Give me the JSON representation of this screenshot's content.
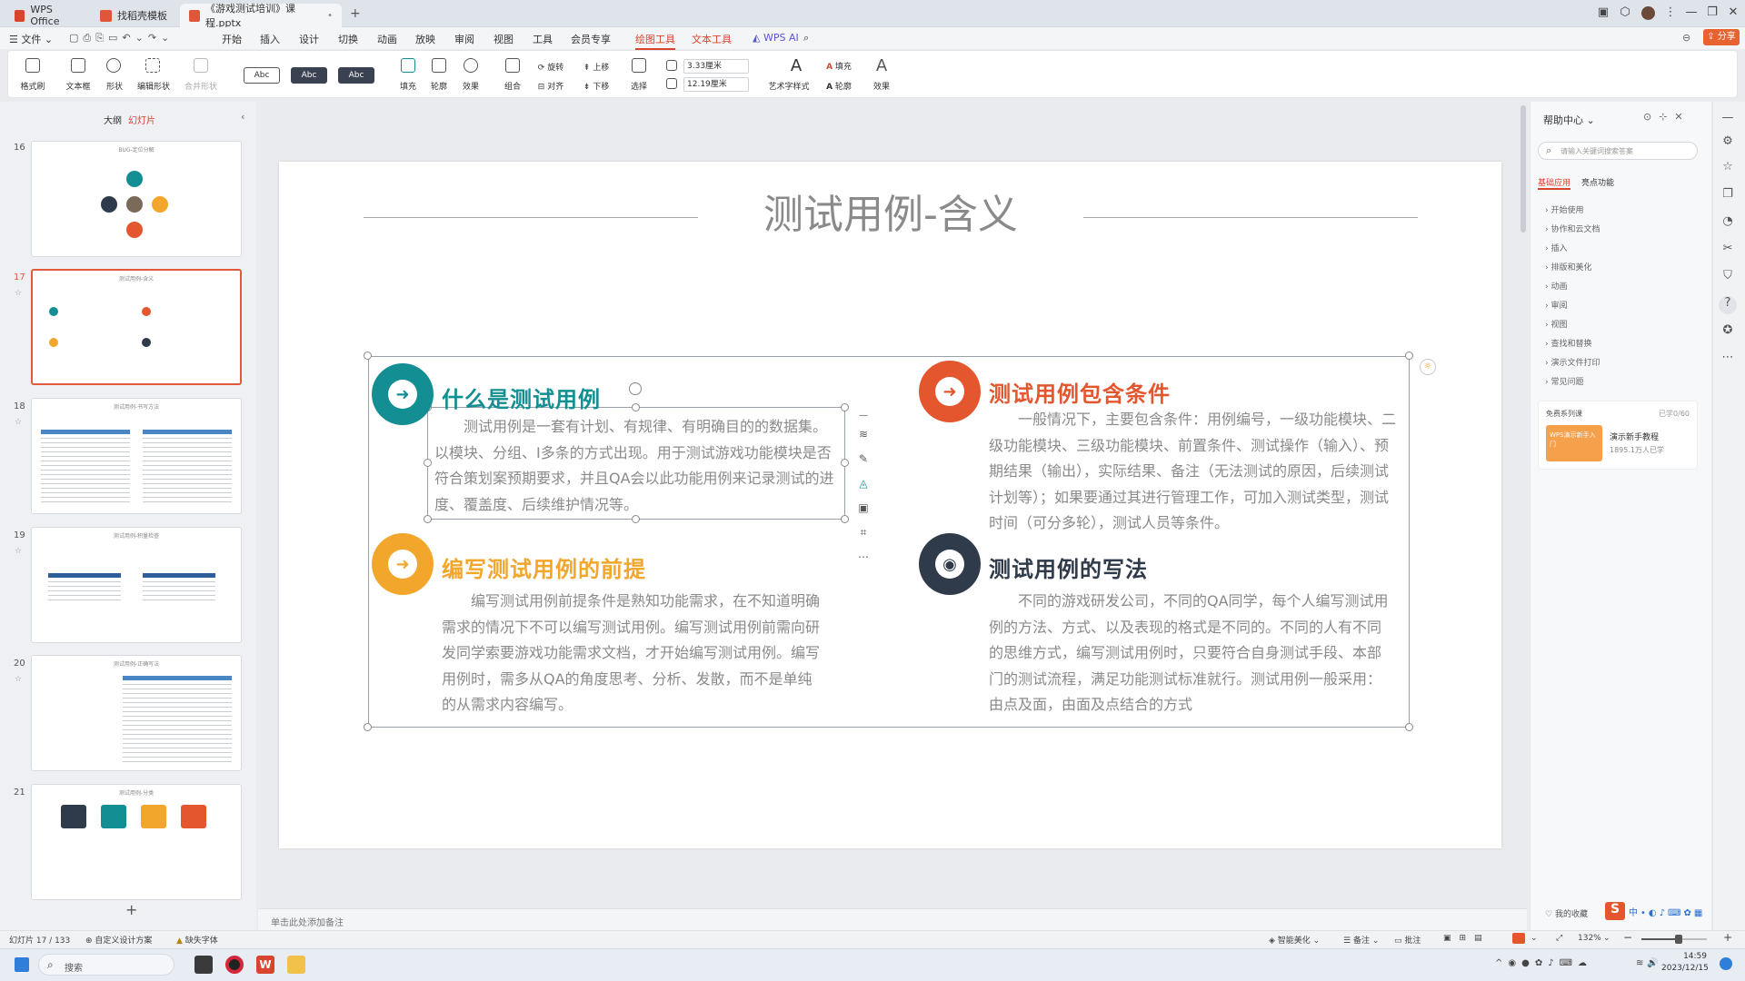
{
  "tabs": [
    {
      "label": "WPS Office",
      "color": "#d9442e"
    },
    {
      "label": "找稻壳模板",
      "color": "#e0563a"
    },
    {
      "label": "《游戏测试培训》课程.pptx",
      "color": "#e0563a"
    }
  ],
  "menu": [
    "文件",
    "开始",
    "插入",
    "设计",
    "切换",
    "动画",
    "放映",
    "审阅",
    "视图",
    "工具",
    "会员专享",
    "绘图工具",
    "文本工具",
    "WPS AI"
  ],
  "share_label": "分享",
  "ribbon": {
    "format_painter": "格式刷",
    "text_box": "文本框",
    "shape": "形状",
    "edit_shape": "编辑形状",
    "merge_shape": "合并形状",
    "styles": [
      "Abc",
      "Abc",
      "Abc"
    ],
    "fill": "填充",
    "outline": "轮廓",
    "effect": "效果",
    "group": "组合",
    "rotate": "旋转",
    "align": "对齐",
    "up": "上移",
    "down": "下移",
    "select": "选择",
    "height": "3.33厘米",
    "width": "12.19厘米",
    "art_style": "艺术字样式",
    "text_fill": "填充",
    "text_outline": "轮廓",
    "text_effect": "效果"
  },
  "left_panel": {
    "tab_outline": "大纲",
    "tab_slides": "幻灯片",
    "slides": [
      {
        "num": "16",
        "title": "BUG-定位分解"
      },
      {
        "num": "17",
        "title": "测试用例-含义"
      },
      {
        "num": "18",
        "title": "测试用例-书写方法"
      },
      {
        "num": "19",
        "title": "测试用例-积量检查"
      },
      {
        "num": "20",
        "title": "测试用例-正确写法"
      },
      {
        "num": "21",
        "title": "测试用例-分类"
      }
    ],
    "add": "+"
  },
  "slide": {
    "title": "测试用例-含义",
    "colors": {
      "teal": "#138e92",
      "orange": "#e4572e",
      "yellow": "#f2a72c",
      "dark": "#2f3b4a"
    },
    "q1": {
      "heading": "什么是测试用例",
      "body": "测试用例是一套有计划、有规律、有明确目的的数据集。以模块、分组、Ⅰ多条的方式出现。用于测试游戏功能模块是否符合策划案预期要求，并且QA会以此功能用例来记录测试的进度、覆盖度、后续维护情况等。"
    },
    "q2": {
      "heading": "测试用例包含条件",
      "body": "一般情况下，主要包含条件：用例编号，一级功能模块、二级功能模块、三级功能模块、前置条件、测试操作（输入）、预期结果（输出），实际结果、备注（无法测试的原因，后续测试计划等）；如果要通过其进行管理工作，可加入测试类型，测试时间（可分多轮），测试人员等条件。"
    },
    "q3": {
      "heading": "编写测试用例的前提",
      "body": "编写测试用例前提条件是熟知功能需求，在不知道明确需求的情况下不可以编写测试用例。编写测试用例前需向研发同学索要游戏功能需求文档，才开始编写测试用例。编写用例时，需多从QA的角度思考、分析、发散，而不是单纯的从需求内容编写。"
    },
    "q4": {
      "heading": "测试用例的写法",
      "body": "不同的游戏研发公司，不同的QA同学，每个人编写测试用例的方法、方式、以及表现的格式是不同的。不同的人有不同的思维方式，编写测试用例时，只要符合自身测试手段、本部门的测试流程，满足功能测试标准就行。测试用例一般采用：由点及面，由面及点结合的方式"
    }
  },
  "notes_placeholder": "单击此处添加备注",
  "help_panel": {
    "title": "帮助中心",
    "search_placeholder": "请输入关键词搜索答案",
    "tab_basic": "基础应用",
    "tab_featured": "亮点功能",
    "items": [
      "开始使用",
      "协作和云文档",
      "插入",
      "排版和美化",
      "动画",
      "审阅",
      "视图",
      "查找和替换",
      "演示文件打印",
      "常见问题"
    ],
    "course_label": "免费系列课",
    "course_progress": "已学0/60",
    "course_title": "演示新手教程",
    "course_thumb_text": "WPS演示新手入门",
    "course_learners": "1895.1万人已学",
    "favorites": "我的收藏"
  },
  "status": {
    "slide_pos": "幻灯片 17 / 133",
    "design": "自定义设计方案",
    "missing_font": "缺失字体",
    "beautify": "智能美化",
    "notes": "备注",
    "comment": "批注",
    "zoom": "132%"
  },
  "taskbar": {
    "search": "搜索",
    "time": "14:59",
    "date": "2023/12/15",
    "ime": "中"
  }
}
